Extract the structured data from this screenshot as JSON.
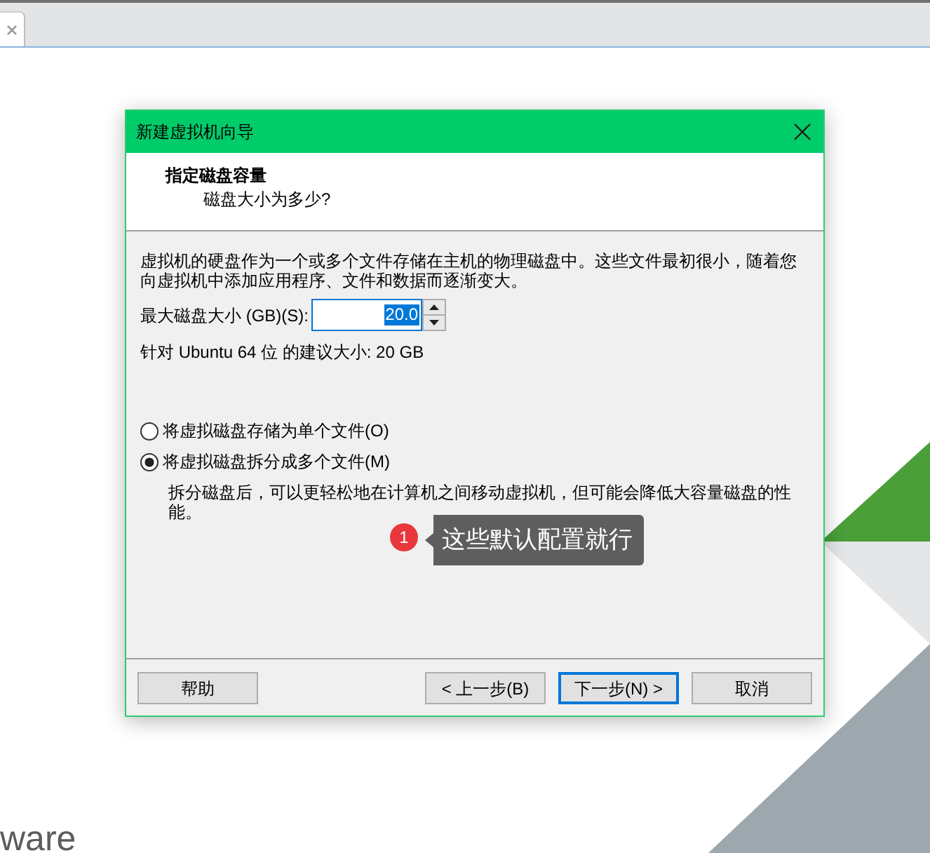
{
  "browser_tabs": [
    {
      "selected": true
    }
  ],
  "dialog": {
    "title": "新建虚拟机向导",
    "header": {
      "title": "指定磁盘容量",
      "subtitle": "磁盘大小为多少?"
    },
    "intro": "虚拟机的硬盘作为一个或多个文件存储在主机的物理磁盘中。这些文件最初很小，随着您向虚拟机中添加应用程序、文件和数据而逐渐变大。",
    "size_field": {
      "label": "最大磁盘大小 (GB)(S):",
      "value": "20.0",
      "value_selected": true
    },
    "recommendation": "针对 Ubuntu 64 位 的建议大小: 20 GB",
    "storage_options": [
      {
        "label": "将虚拟磁盘存储为单个文件(O)",
        "selected": false
      },
      {
        "label": "将虚拟磁盘拆分成多个文件(M)",
        "selected": true,
        "description": "拆分磁盘后，可以更轻松地在计算机之间移动虚拟机，但可能会降低大容量磁盘的性能。"
      }
    ],
    "buttons": [
      {
        "label": "帮助",
        "kind": "help",
        "focused": false
      },
      {
        "label": "< 上一步(B)",
        "kind": "back",
        "focused": false
      },
      {
        "label": "下一步(N) >",
        "kind": "next",
        "focused": true
      },
      {
        "label": "取消",
        "kind": "cancel",
        "focused": false
      }
    ]
  },
  "annotation": {
    "number": "1",
    "text": "这些默认配置就行"
  },
  "logo_text": "ware"
}
